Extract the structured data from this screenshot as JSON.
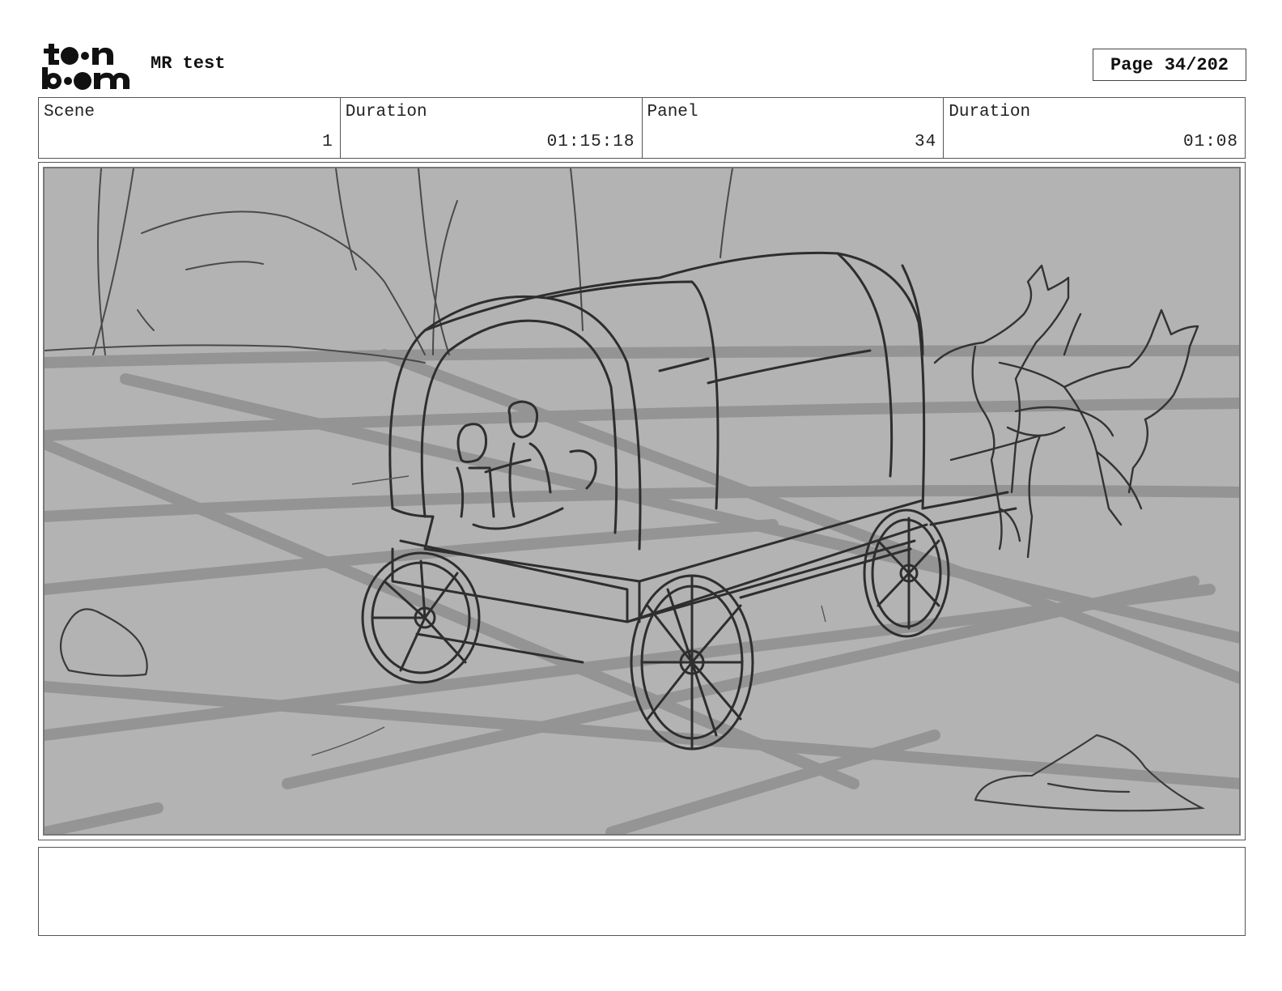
{
  "header": {
    "logo_line1": "toon",
    "logo_line2": "boom",
    "title": "MR test",
    "page_label": "Page",
    "page_value": "34/202"
  },
  "info": {
    "scene_label": "Scene",
    "scene_value": "1",
    "scene_duration_label": "Duration",
    "scene_duration_value": "01:15:18",
    "panel_label": "Panel",
    "panel_value": "34",
    "panel_duration_label": "Duration",
    "panel_duration_value": "01:08"
  },
  "panel": {
    "background_color": "#b3b3b3",
    "sketch_color": "#3a3a3a",
    "road_color": "#8f8f8f"
  },
  "notes": {
    "text": ""
  }
}
